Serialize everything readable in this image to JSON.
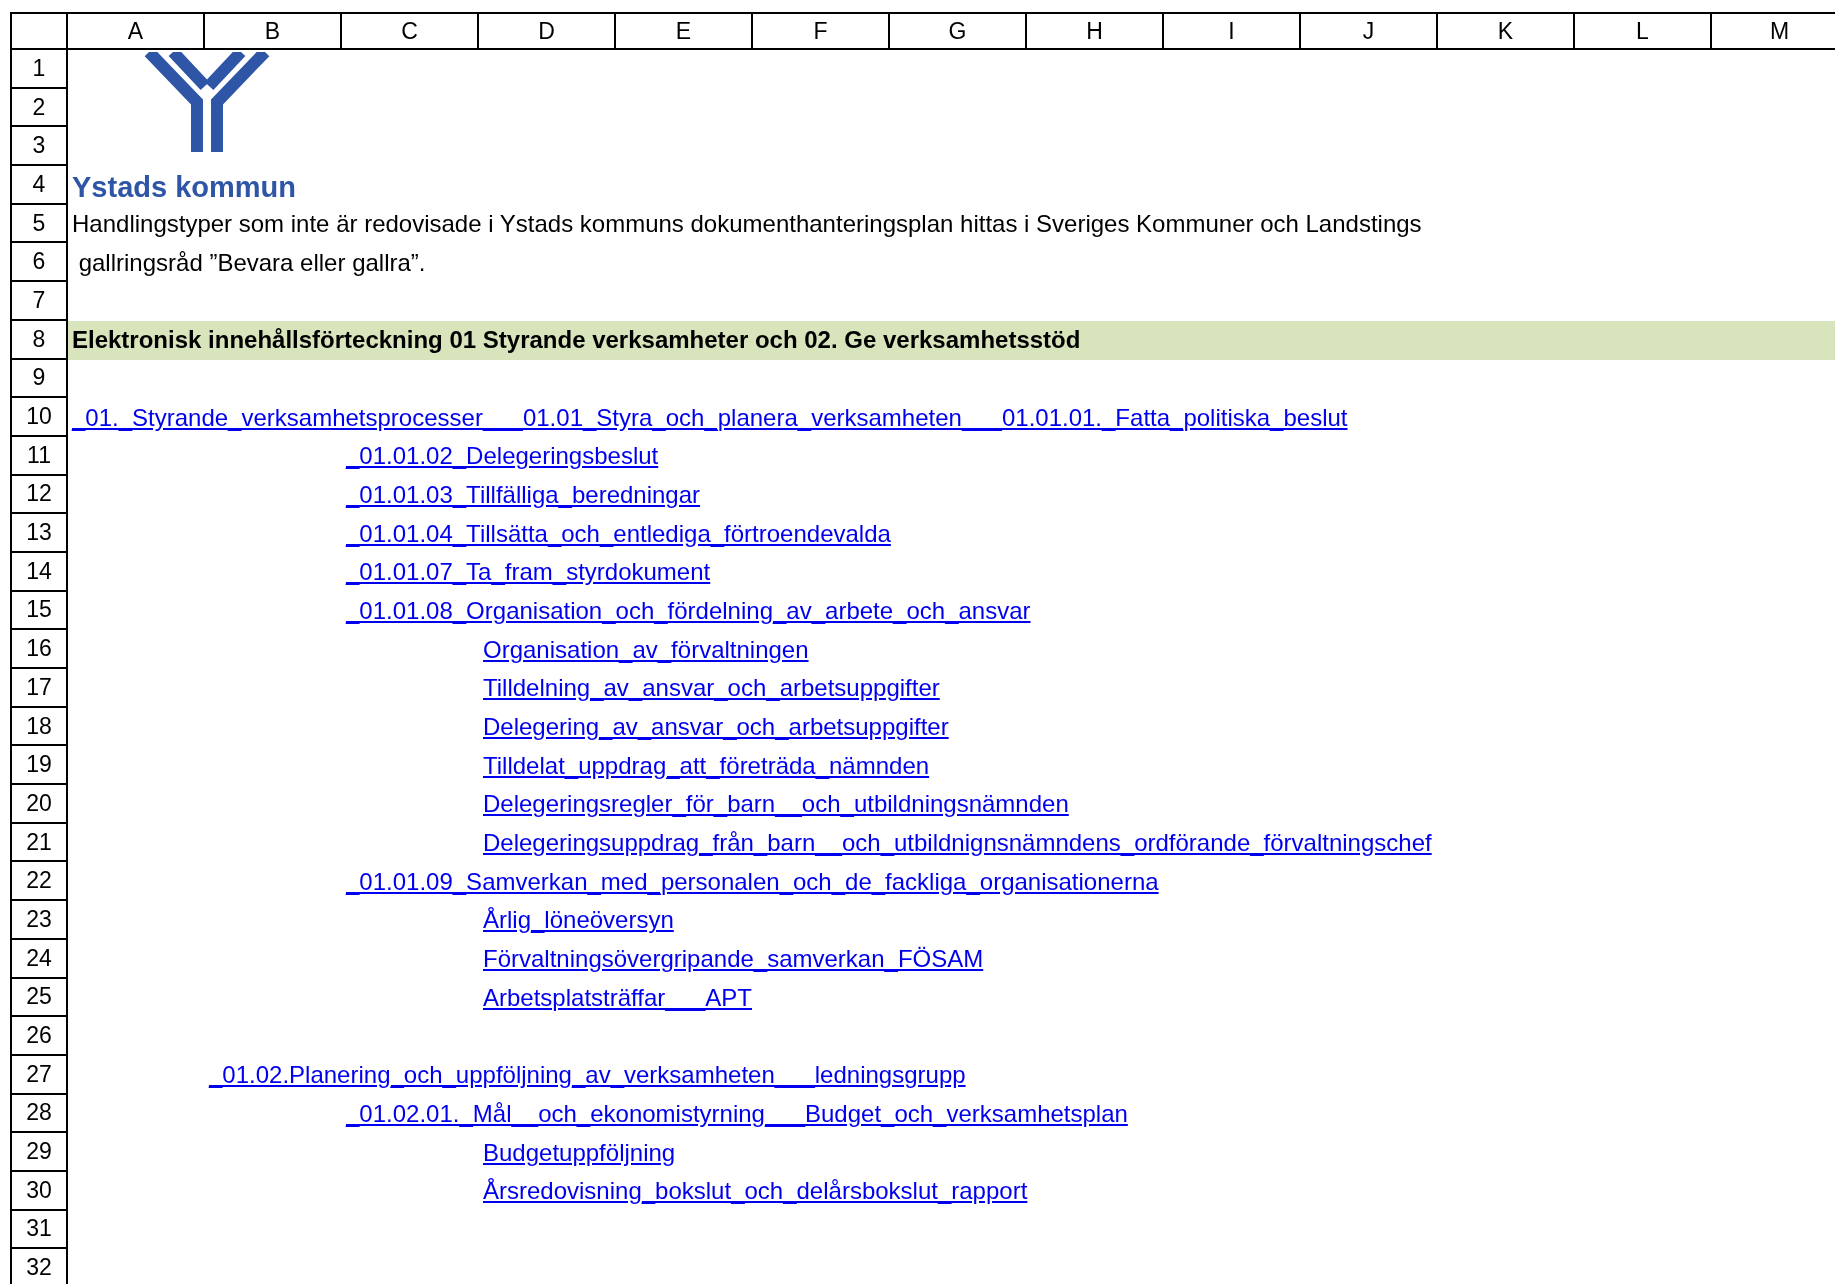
{
  "columns": [
    "A",
    "B",
    "C",
    "D",
    "E",
    "F",
    "G",
    "H",
    "I",
    "J",
    "K",
    "L",
    "M"
  ],
  "rows": [
    {
      "number": "1"
    },
    {
      "number": "2"
    },
    {
      "number": "3"
    },
    {
      "number": "4",
      "cell": {
        "kind": "logo",
        "text": "Ystads kommun"
      }
    },
    {
      "number": "5",
      "cell": {
        "kind": "text",
        "text": "Handlingstyper som inte är redovisade i Ystads kommuns dokumenthanteringsplan hittas i Sveriges Kommuner och Landstings"
      }
    },
    {
      "number": "6",
      "cell": {
        "kind": "text",
        "text": " gallringsråd ”Bevara eller gallra”."
      }
    },
    {
      "number": "7"
    },
    {
      "number": "8",
      "cell": {
        "kind": "heading",
        "text": "Elektronisk innehållsförteckning 01 Styrande verksamheter och 02. Ge verksamhetsstöd"
      }
    },
    {
      "number": "9"
    },
    {
      "number": "10",
      "cell": {
        "kind": "process",
        "text": "_01._Styrande_verksamhetsprocesser___01.01_Styra_och_planera_verksamheten___01.01.01._Fatta_politiska_beslut"
      }
    },
    {
      "number": "11",
      "cell": {
        "kind": "activity",
        "text": "_01.01.02_Delegeringsbeslut"
      }
    },
    {
      "number": "12",
      "cell": {
        "kind": "activity",
        "text": "_01.01.03_Tillfälliga_beredningar"
      }
    },
    {
      "number": "13",
      "cell": {
        "kind": "activity",
        "text": "_01.01.04_Tillsätta_och_entlediga_förtroendevalda"
      }
    },
    {
      "number": "14",
      "cell": {
        "kind": "activity",
        "text": "_01.01.07_Ta_fram_styrdokument"
      }
    },
    {
      "number": "15",
      "cell": {
        "kind": "activity",
        "text": "_01.01.08_Organisation_och_fördelning_av_arbete_och_ansvar"
      }
    },
    {
      "number": "16",
      "cell": {
        "kind": "document",
        "text": "Organisation_av_förvaltningen"
      }
    },
    {
      "number": "17",
      "cell": {
        "kind": "document",
        "text": "Tilldelning_av_ansvar_och_arbetsuppgifter"
      }
    },
    {
      "number": "18",
      "cell": {
        "kind": "document",
        "text": "Delegering_av_ansvar_och_arbetsuppgifter"
      }
    },
    {
      "number": "19",
      "cell": {
        "kind": "document",
        "text": "Tilldelat_uppdrag_att_företräda_nämnden"
      }
    },
    {
      "number": "20",
      "cell": {
        "kind": "document",
        "text": "Delegeringsregler_för_barn__och_utbildningsnämnden"
      }
    },
    {
      "number": "21",
      "cell": {
        "kind": "document",
        "text": "Delegeringsuppdrag_från_barn__och_utbildnignsnämndens_ordförande_förvaltningschef"
      }
    },
    {
      "number": "22",
      "cell": {
        "kind": "activity",
        "text": "_01.01.09_Samverkan_med_personalen_och_de_fackliga_organisationerna"
      }
    },
    {
      "number": "23",
      "cell": {
        "kind": "document",
        "text": "Årlig_löneöversyn"
      }
    },
    {
      "number": "24",
      "cell": {
        "kind": "document",
        "text": "Förvaltningsövergripande_samverkan_FÖSAM"
      }
    },
    {
      "number": "25",
      "cell": {
        "kind": "document",
        "text": "Arbetsplatsträffar___APT"
      }
    },
    {
      "number": "26"
    },
    {
      "number": "27",
      "cell": {
        "kind": "subprocess",
        "text": "_01.02.Planering_och_uppföljning_av_verksamheten___ledningsgrupp"
      }
    },
    {
      "number": "28",
      "cell": {
        "kind": "activity",
        "text": "_01.02.01._Mål__och_ekonomistyrning___Budget_och_verksamhetsplan"
      }
    },
    {
      "number": "29",
      "cell": {
        "kind": "document",
        "text": "Budgetuppföljning"
      }
    },
    {
      "number": "30",
      "cell": {
        "kind": "document",
        "text": "Årsredovisning_bokslut_och_delårsbokslut_rapport"
      }
    },
    {
      "number": "31"
    },
    {
      "number": "32"
    }
  ]
}
